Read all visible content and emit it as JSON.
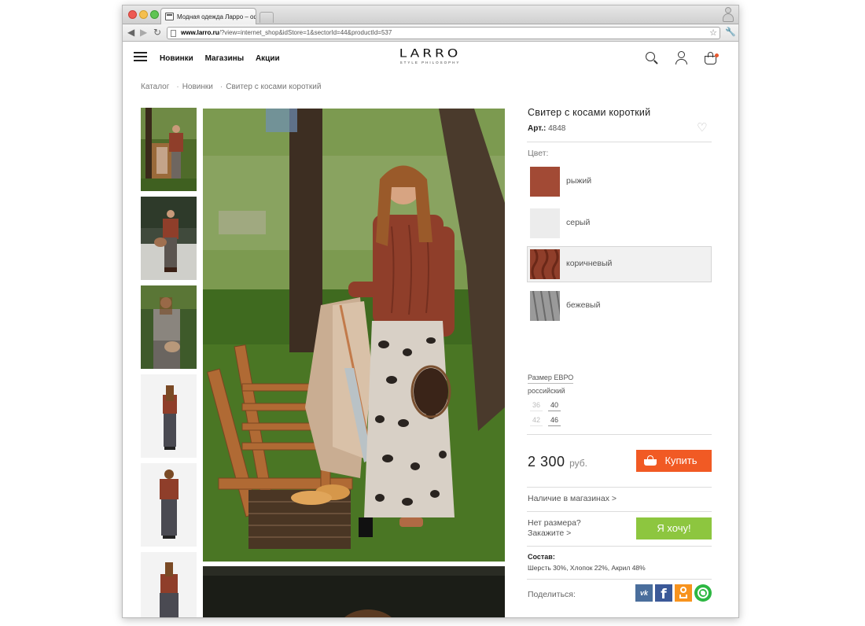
{
  "browser": {
    "tab_title": "Модная одежда Ларро – оф",
    "url_host": "www.larro.ru",
    "url_path": "/?view=internet_shop&idStore=1&sectorId=44&productId=537"
  },
  "header": {
    "nav": [
      "Новинки",
      "Магазины",
      "Акции"
    ],
    "logo_text": "LARRO",
    "logo_tagline": "STYLE PHILOSOPHY"
  },
  "breadcrumb": [
    "Каталог",
    "Новинки",
    "Свитер с косами короткий"
  ],
  "breadcrumb_separator": "·",
  "product": {
    "title": "Свитер с косами короткий",
    "article_label": "Арт.:",
    "article": "4848",
    "color_label": "Цвет:",
    "colors": [
      {
        "name": "рыжий",
        "hex": "#a24a35"
      },
      {
        "name": "серый",
        "hex": "#ececec"
      },
      {
        "name": "коричневый",
        "hex": "#8f3e2a"
      },
      {
        "name": "бежевый",
        "hex": "#9a9a9a"
      }
    ],
    "selected_color": "коричневый",
    "size_system": "Размер ЕВРО",
    "size_subtitle": "российский",
    "sizes": [
      {
        "eu": "36",
        "ru": "42",
        "available": false
      },
      {
        "eu": "40",
        "ru": "46",
        "available": true
      }
    ],
    "price": "2 300",
    "currency": "руб.",
    "buy_label": "Купить",
    "stores_link": "Наличие в магазинах >",
    "no_size_line1": "Нет размера?",
    "no_size_line2": "Закажите >",
    "want_label": "Я хочу!",
    "composition_label": "Состав:",
    "composition": "Шерсть 30%, Хлопок 22%, Акрил 48%",
    "share_label": "Поделиться:"
  },
  "social": [
    {
      "name": "vk",
      "label": "vk",
      "color": "#4a6e9c"
    },
    {
      "name": "facebook",
      "label": "f",
      "color": "#3b5998"
    },
    {
      "name": "odnoklassniki",
      "color": "#f7931e"
    },
    {
      "name": "whatsapp",
      "color": "#2db742"
    }
  ],
  "accent_colors": {
    "buy": "#f15a24",
    "want": "#8dc63f",
    "cart_dot": "#e9592f"
  }
}
